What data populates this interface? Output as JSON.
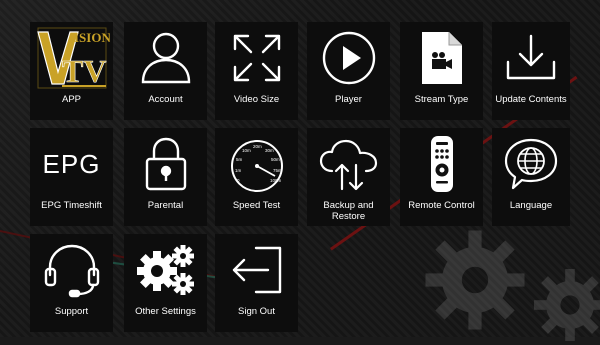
{
  "menu": {
    "items": [
      {
        "id": "app",
        "label": "APP",
        "icon": "vision-tv-logo"
      },
      {
        "id": "account",
        "label": "Account",
        "icon": "user-icon"
      },
      {
        "id": "video-size",
        "label": "Video Size",
        "icon": "expand-icon"
      },
      {
        "id": "player",
        "label": "Player",
        "icon": "play-icon"
      },
      {
        "id": "stream-type",
        "label": "Stream Type",
        "icon": "video-file-icon"
      },
      {
        "id": "update-contents",
        "label": "Update Contents",
        "icon": "download-icon"
      },
      {
        "id": "epg-timeshift",
        "label": "EPG Timeshift",
        "icon": "epg-icon",
        "icon_text": "EPG"
      },
      {
        "id": "parental",
        "label": "Parental",
        "icon": "lock-icon"
      },
      {
        "id": "speed-test",
        "label": "Speed Test",
        "icon": "speedometer-icon"
      },
      {
        "id": "backup-restore",
        "label": "Backup and Restore",
        "icon": "cloud-sync-icon"
      },
      {
        "id": "remote-control",
        "label": "Remote Control",
        "icon": "remote-icon"
      },
      {
        "id": "language",
        "label": "Language",
        "icon": "globe-chat-icon"
      },
      {
        "id": "support",
        "label": "Support",
        "icon": "headset-icon"
      },
      {
        "id": "other-settings",
        "label": "Other Settings",
        "icon": "gears-icon"
      },
      {
        "id": "sign-out",
        "label": "Sign Out",
        "icon": "sign-out-icon"
      }
    ]
  },
  "logo": {
    "top_text": "ISION",
    "letters": "TV"
  },
  "speedometer": {
    "ticks": [
      "0",
      "1m",
      "5m",
      "10m",
      "20m",
      "30m",
      "50m",
      "75m",
      "100m"
    ]
  },
  "colors": {
    "tile_bg": "#0d0d0d",
    "logo_gold": "#c9a227",
    "text": "#ffffff",
    "accent_red": "#7a1010"
  }
}
